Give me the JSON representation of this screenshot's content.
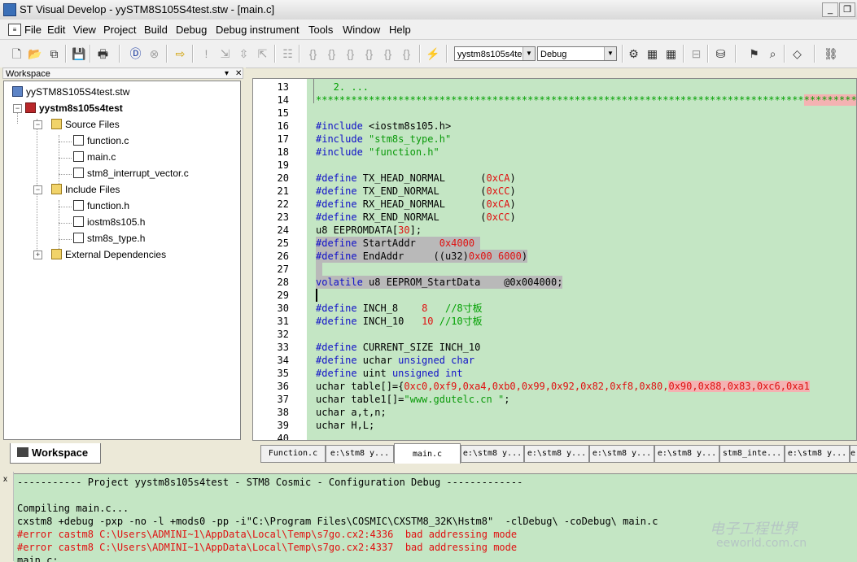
{
  "window": {
    "title": "ST Visual Develop - yySTM8S105S4test.stw - [main.c]",
    "buttons": {
      "minimize": "_",
      "restore": "❐",
      "close": "x"
    }
  },
  "menu": [
    "File",
    "Edit",
    "View",
    "Project",
    "Build",
    "Debug",
    "Debug instrument",
    "Tools",
    "Window",
    "Help"
  ],
  "toolbar": {
    "project_combo": "yystm8s105s4te",
    "config_combo": "Debug"
  },
  "workspace": {
    "header": "Workspace",
    "tab_label": "Workspace",
    "tree": {
      "workspace_file": "yySTM8S105S4test.stw",
      "project": "yystm8s105s4test",
      "source_folder": "Source Files",
      "source_files": [
        "function.c",
        "main.c",
        "stm8_interrupt_vector.c"
      ],
      "include_folder": "Include Files",
      "include_files": [
        "function.h",
        "iostm8s105.h",
        "stm8s_type.h"
      ],
      "deps_folder": "External Dependencies"
    }
  },
  "editor": {
    "line_numbers": [
      "13",
      "14",
      "15",
      "16",
      "17",
      "18",
      "19",
      "20",
      "21",
      "22",
      "23",
      "24",
      "25",
      "26",
      "27",
      "28",
      "29",
      "30",
      "31",
      "32",
      "33",
      "34",
      "35",
      "36",
      "37",
      "38",
      "39",
      "40"
    ],
    "code": {
      "l13": "   2. ...",
      "l14a": "***********************************************************************************",
      "l14b": "*****************************/",
      "l16a": "#include",
      "l16b": " <iostm8s105.h>",
      "l17a": "#include",
      "l17b": " \"stm8s_type.h\"",
      "l18a": "#include",
      "l18b": " \"function.h\"",
      "l20a": "#define",
      "l20b": " TX_HEAD_NORMAL      (",
      "l20c": "0xCA",
      "l20d": ")",
      "l21a": "#define",
      "l21b": " TX_END_NORMAL       (",
      "l21c": "0xCC",
      "l21d": ")",
      "l22a": "#define",
      "l22b": " RX_HEAD_NORMAL      (",
      "l22c": "0xCA",
      "l22d": ")",
      "l23a": "#define",
      "l23b": " RX_END_NORMAL       (",
      "l23c": "0xCC",
      "l23d": ")",
      "l24a": "u8 EEPROMDATA[",
      "l24b": "30",
      "l24c": "];",
      "l25a": "#define",
      "l25b": " StartAddr    ",
      "l25c": "0x4000",
      "l25d": " ",
      "l26a": "#define",
      "l26b": " EndAddr     ((u32)",
      "l26c": "0x00 6000",
      "l26d": ")",
      "l27": " ",
      "l28a": "volatile",
      "l28b": " u8 EEPROM_StartData    @0x004000;",
      "l30a": "#define",
      "l30b": " INCH_8    ",
      "l30c": "8",
      "l30d": "   //8寸板",
      "l31a": "#define",
      "l31b": " INCH_10   ",
      "l31c": "10",
      "l31d": " //10寸板",
      "l33a": "#define",
      "l33b": " CURRENT_SIZE INCH_10",
      "l34a": "#define",
      "l34b": " uchar ",
      "l34c": "unsigned char",
      "l35a": "#define",
      "l35b": " uint ",
      "l35c": "unsigned int",
      "l36a": "uchar table[]={",
      "l36b": "0xc0,0xf9,0xa4,0xb0,0x99,0x92,0x82,0xf8,0x80,",
      "l36c": "0x90,0x88,0x83,0xc6,0xa1",
      "l37a": "uchar table1[]=",
      "l37b": "\"www.gdutelc.cn \"",
      "l37c": ";",
      "l38": "uchar a,t,n;",
      "l39": "uchar H,L;"
    }
  },
  "doc_tabs": [
    "Function.c",
    "e:\\stm8 y...",
    "main.c",
    "e:\\stm8 y...",
    "e:\\stm8 y...",
    "e:\\stm8 y...",
    "e:\\stm8 y...",
    "stm8_inte...",
    "e:\\stm8 y...",
    "e:"
  ],
  "output": {
    "lines": [
      "----------- Project yystm8s105s4test - STM8 Cosmic - Configuration Debug -------------",
      "",
      "Compiling main.c...",
      "cxstm8 +debug -pxp -no -l +mods0 -pp -i\"C:\\Program Files\\COSMIC\\CXSTM8_32K\\Hstm8\"  -clDebug\\ -coDebug\\ main.c",
      "#error castm8 C:\\Users\\ADMINI~1\\AppData\\Local\\Temp\\s7go.cx2:4336  bad addressing mode",
      "#error castm8 C:\\Users\\ADMINI~1\\AppData\\Local\\Temp\\s7go.cx2:4337  bad addressing mode",
      "main.c:"
    ],
    "close": "x"
  },
  "watermark": {
    "cn": "电子工程世界",
    "en": "eeworld.com.cn"
  }
}
